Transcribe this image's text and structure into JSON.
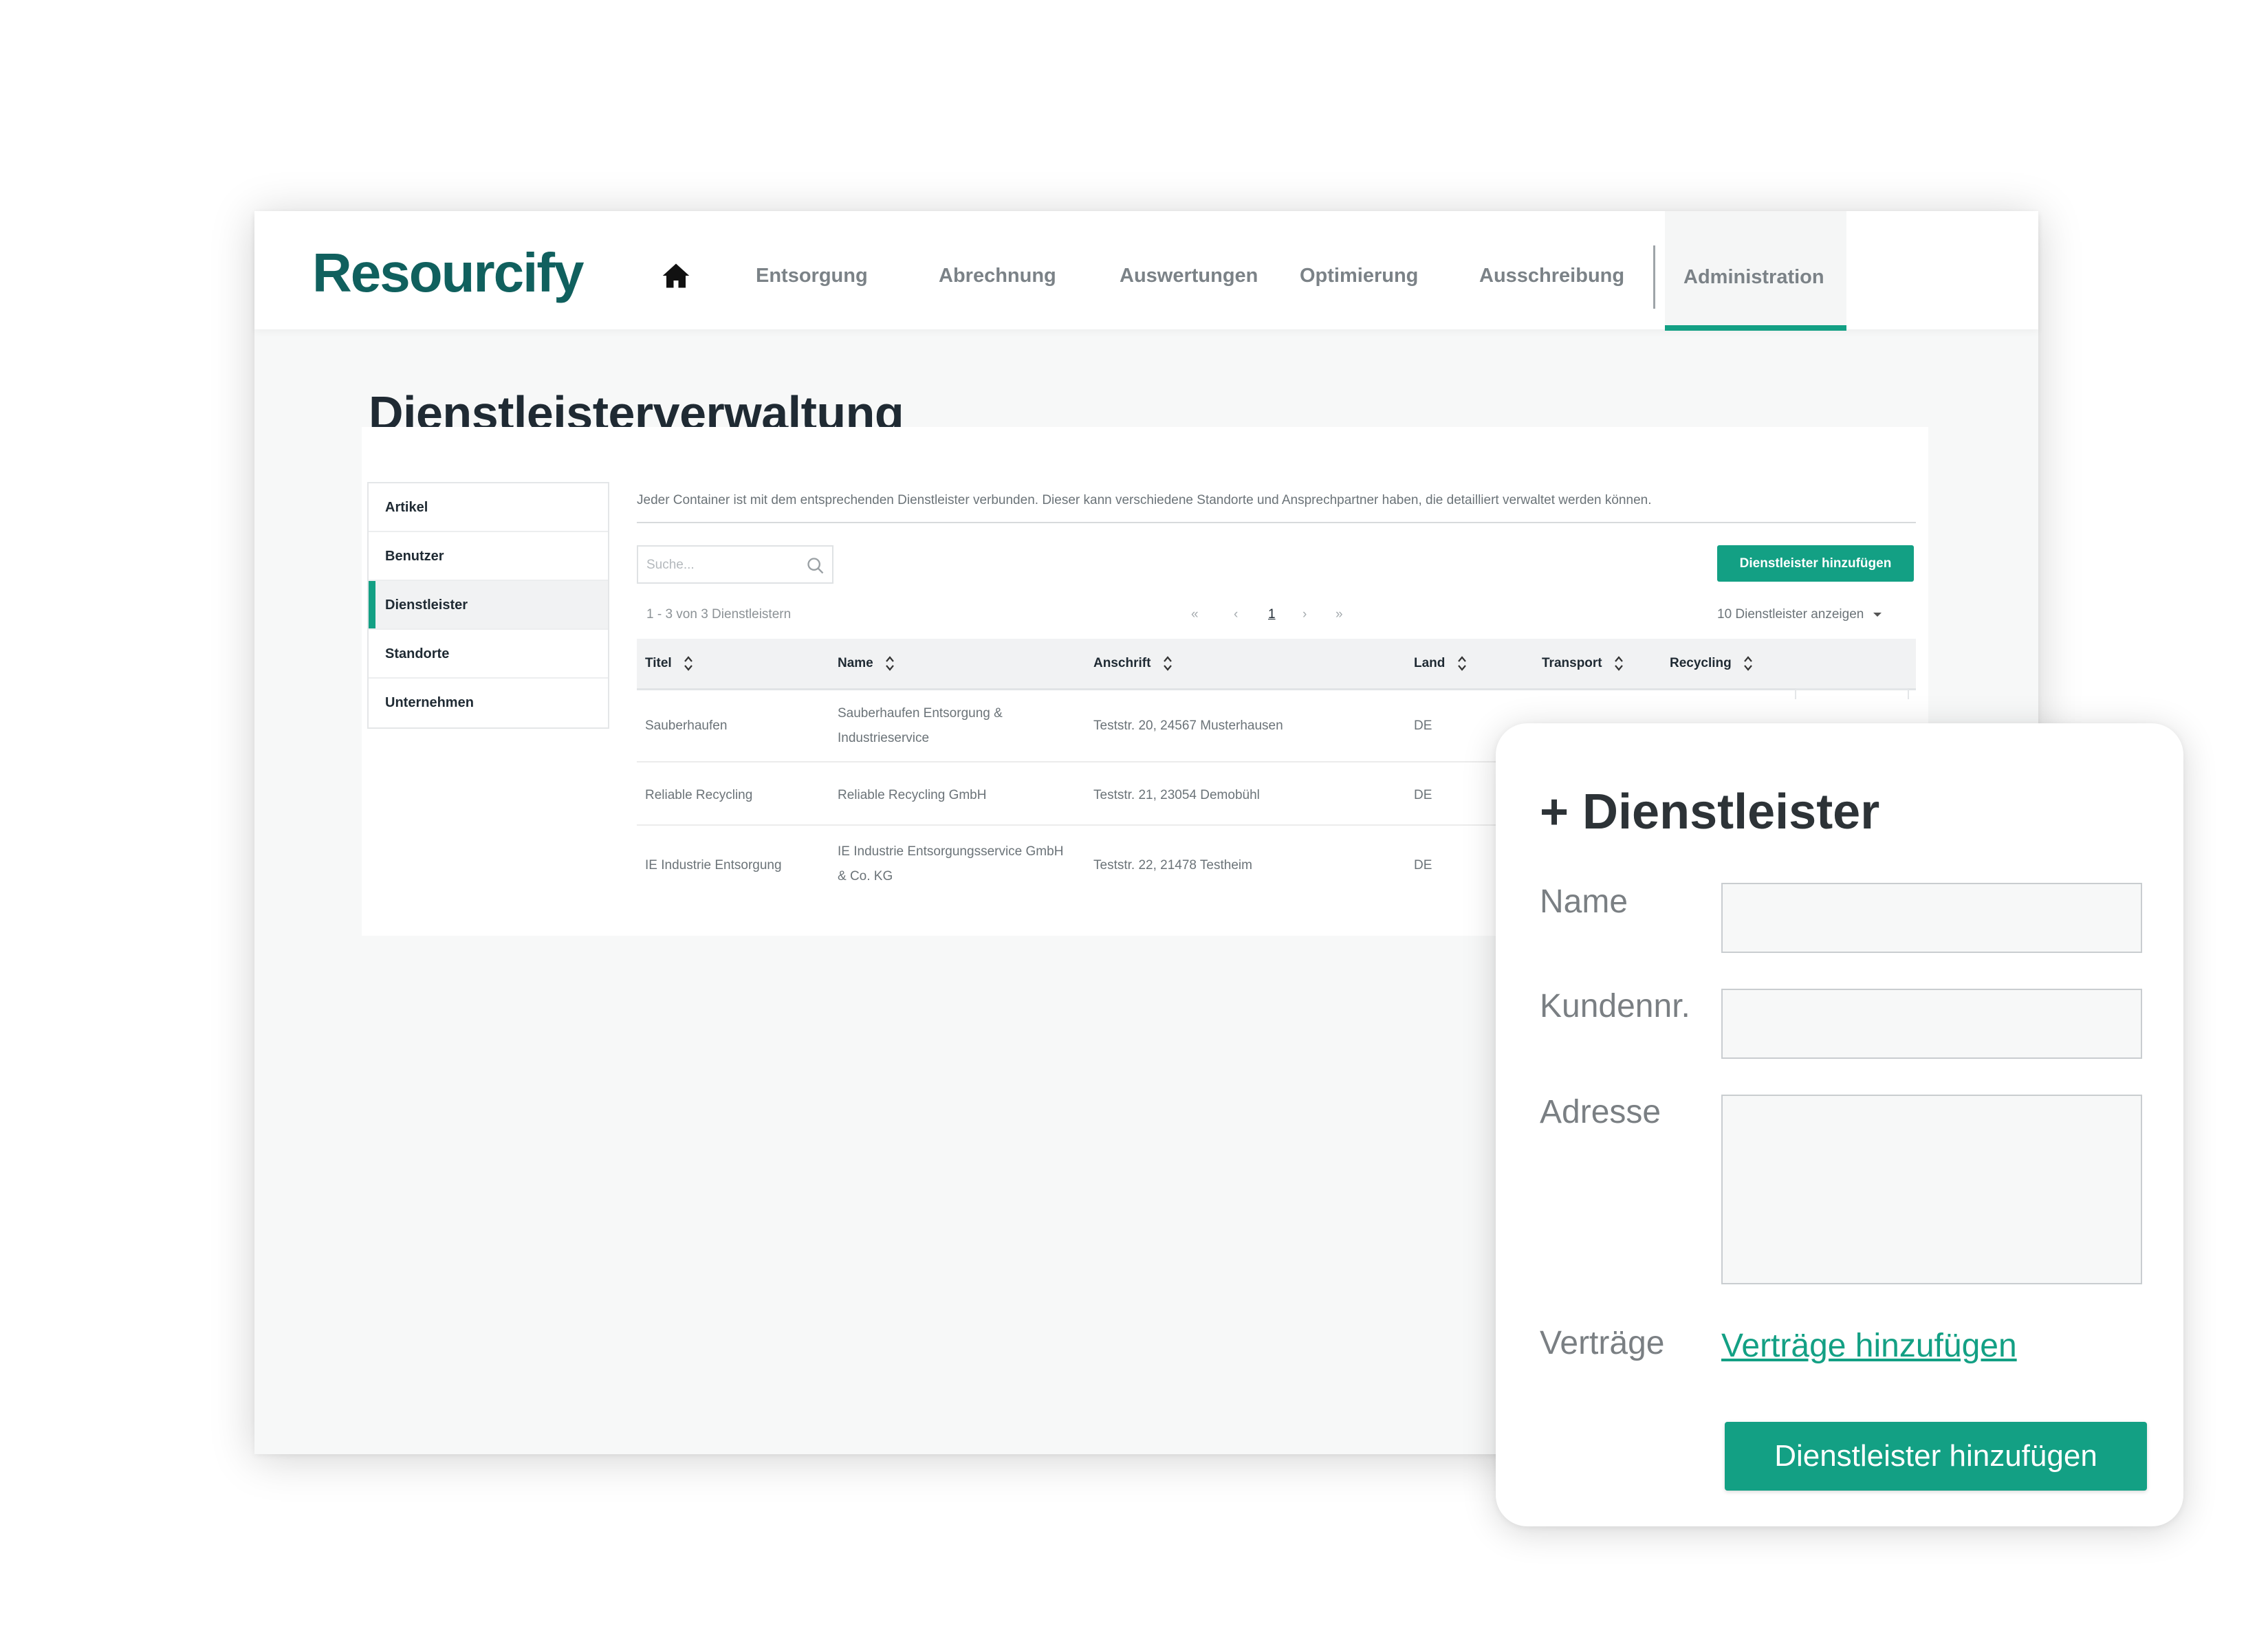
{
  "brand": {
    "name": "Resourcify",
    "primary_color": "#13a084",
    "logo_color": "#10605e"
  },
  "nav": {
    "home_icon": "home-icon",
    "items": [
      "Entsorgung",
      "Abrechnung",
      "Auswertungen",
      "Optimierung",
      "Ausschreibung",
      "Administration"
    ],
    "active": "Administration"
  },
  "page": {
    "title": "Dienstleisterverwaltung",
    "sidebar": {
      "items": [
        "Artikel",
        "Benutzer",
        "Dienstleister",
        "Standorte",
        "Unternehmen"
      ],
      "active": "Dienstleister"
    },
    "intro": "Jeder Container ist mit dem entsprechenden Dienstleister verbunden. Dieser kann verschiedene Standorte und Ansprechpartner haben, die detailliert verwaltet werden können.",
    "search": {
      "placeholder": "Suche..."
    },
    "add_button": "Dienstleister hinzufügen",
    "count_text": "1 - 3 von 3 Dienstleistern",
    "pagination": {
      "first": "«",
      "prev": "‹",
      "current": "1",
      "next": "›",
      "last": "»"
    },
    "per_page": "10 Dienstleister anzeigen",
    "table": {
      "columns": [
        "Titel",
        "Name",
        "Anschrift",
        "Land",
        "Transport",
        "Recycling"
      ],
      "rows": [
        {
          "titel": "Sauberhaufen",
          "name": "Sauberhaufen Entsorgung & Industrieservice",
          "anschrift": "Teststr. 20, 24567 Musterhausen",
          "land": "DE"
        },
        {
          "titel": "Reliable Recycling",
          "name": "Reliable Recycling GmbH",
          "anschrift": "Teststr. 21, 23054 Demobühl",
          "land": "DE"
        },
        {
          "titel": "IE Industrie Entsorgung",
          "name": "IE Industrie Entsorgungsservice GmbH & Co. KG",
          "anschrift": "Teststr. 22, 21478 Testheim",
          "land": "DE"
        }
      ]
    }
  },
  "modal": {
    "title": "+ Dienstleister",
    "fields": {
      "name": {
        "label": "Name",
        "value": ""
      },
      "kundennr": {
        "label": "Kundennr.",
        "value": ""
      },
      "adresse": {
        "label": "Adresse",
        "value": ""
      }
    },
    "vertraege_label": "Verträge",
    "vertraege_link": "Verträge hinzufügen",
    "submit": "Dienstleister hinzufügen"
  }
}
